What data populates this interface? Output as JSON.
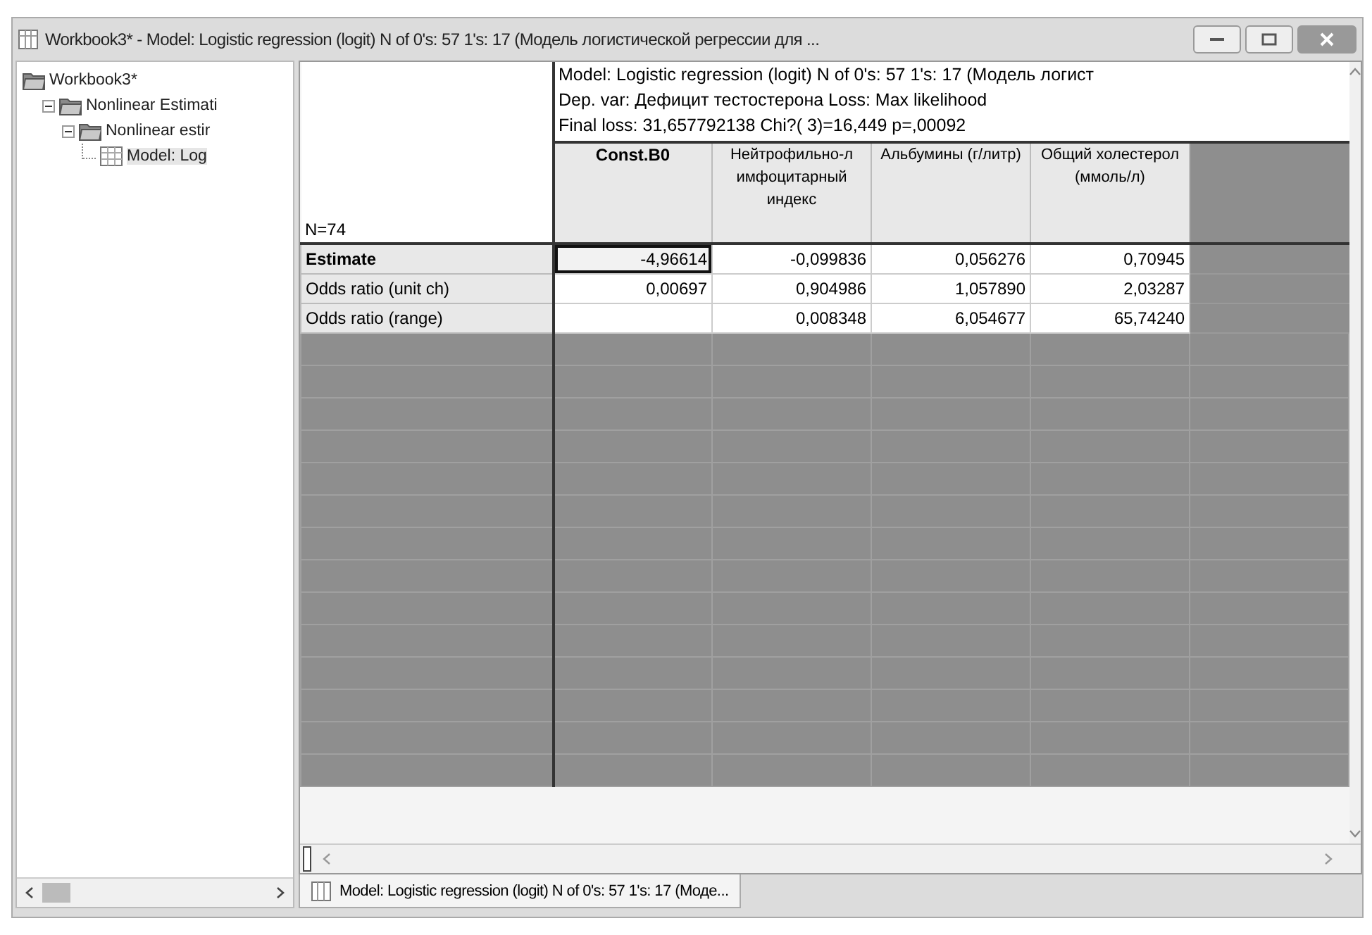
{
  "window": {
    "title": "Workbook3* - Model: Logistic regression (logit) N of 0's: 57 1's: 17 (Модель логистической регрессии для ..."
  },
  "tree": [
    {
      "label": "Workbook3*",
      "kind": "folder",
      "children": [
        {
          "label": "Nonlinear Estimati",
          "kind": "folder",
          "expanded": true,
          "children": [
            {
              "label": "Nonlinear estir",
              "kind": "folder",
              "expanded": true,
              "children": [
                {
                  "label": "Model: Log",
                  "kind": "sheet",
                  "selected": true
                }
              ]
            }
          ]
        }
      ]
    }
  ],
  "sheet": {
    "header_lines": [
      "Model: Logistic regression (logit) N of 0's: 57 1's: 17 (Модель логист",
      "Dep. var: Дефицит тестостерона Loss: Max likelihood",
      "Final loss: 31,657792138 Chi?( 3)=16,449 p=,00092"
    ],
    "corner": "N=74",
    "columns": [
      {
        "label": "Const.B0",
        "bold": true
      },
      {
        "label": "Нейтрофильно-л имфоцитарный индекс",
        "bold": false
      },
      {
        "label": "Альбумины (г/литр)",
        "bold": false
      },
      {
        "label": "Общий холестерол (ммоль/л)",
        "bold": false
      }
    ],
    "rows": [
      {
        "label": "Estimate",
        "bold": true,
        "cells": [
          {
            "text": "-4,96614",
            "selected": true
          },
          {
            "text": "-0,099836",
            "selected": false
          },
          {
            "text": "0,056276",
            "selected": false
          },
          {
            "text": "0,70945",
            "selected": false
          }
        ]
      },
      {
        "label": "Odds ratio (unit ch)",
        "bold": false,
        "cells": [
          {
            "text": "0,00697",
            "selected": false
          },
          {
            "text": "0,904986",
            "selected": false
          },
          {
            "text": "1,057890",
            "selected": false
          },
          {
            "text": "2,03287",
            "selected": false
          }
        ]
      },
      {
        "label": "Odds ratio (range)",
        "bold": false,
        "cells": [
          {
            "selected": false
          },
          {
            "text": "0,008348",
            "selected": false
          },
          {
            "text": "6,054677",
            "selected": false
          },
          {
            "text": "65,74240",
            "selected": false
          }
        ]
      }
    ]
  },
  "tabs": [
    {
      "label": "Model: Logistic regression (logit) N of 0's: 57 1's: 17 (Моде...",
      "selected": true
    }
  ]
}
